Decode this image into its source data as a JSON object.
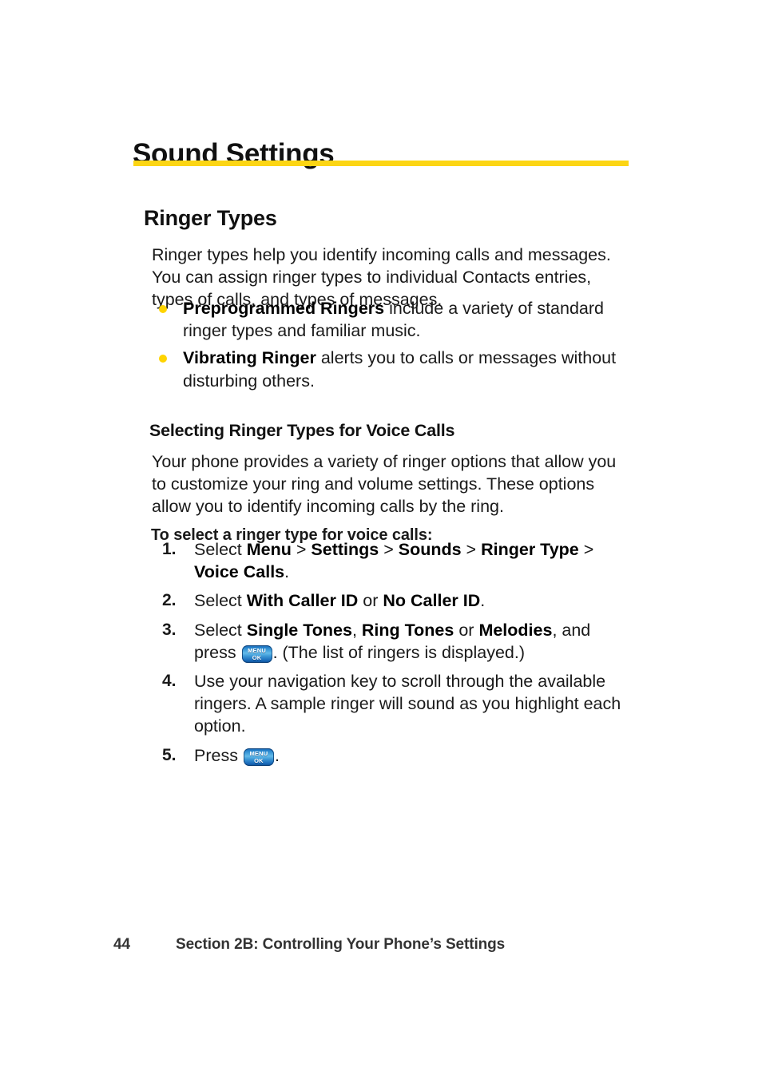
{
  "document": {
    "chapter_title": "Sound Settings",
    "accent_color": "#FCD514",
    "bullet_color": "#FFD400",
    "key_color": "#2f8ed2"
  },
  "section": {
    "heading": "Ringer Types",
    "intro_paragraph": "Ringer types help you identify incoming calls and messages. You can assign ringer types to individual Contacts entries, types of calls, and types of messages.",
    "bullets": [
      {
        "term": "Preprogrammed Ringers",
        "text": " include a variety of standard ringer types and familiar music."
      },
      {
        "term": "Vibrating Ringer",
        "text": " alerts you to calls or messages without disturbing others."
      }
    ]
  },
  "subsection": {
    "heading": "Selecting Ringer Types for Voice Calls",
    "paragraph": "Your phone provides a variety of ringer options that allow you to customize your ring and volume settings. These options allow you to identify incoming calls by the ring.",
    "procedure_lead": "To select a ringer type for voice calls:",
    "steps": [
      {
        "number": "1.",
        "parts": [
          {
            "type": "text",
            "value": "Select "
          },
          {
            "type": "bold",
            "value": "Menu"
          },
          {
            "type": "text",
            "value": " > "
          },
          {
            "type": "bold",
            "value": "Settings"
          },
          {
            "type": "text",
            "value": " > "
          },
          {
            "type": "bold",
            "value": "Sounds"
          },
          {
            "type": "text",
            "value": " > "
          },
          {
            "type": "bold",
            "value": "Ringer Type"
          },
          {
            "type": "text",
            "value": " > "
          },
          {
            "type": "bold",
            "value": "Voice Calls"
          },
          {
            "type": "text",
            "value": "."
          }
        ]
      },
      {
        "number": "2.",
        "parts": [
          {
            "type": "text",
            "value": "Select "
          },
          {
            "type": "bold",
            "value": "With Caller ID"
          },
          {
            "type": "text",
            "value": " or "
          },
          {
            "type": "bold",
            "value": "No Caller ID"
          },
          {
            "type": "text",
            "value": "."
          }
        ]
      },
      {
        "number": "3.",
        "parts": [
          {
            "type": "text",
            "value": "Select "
          },
          {
            "type": "bold",
            "value": "Single Tones"
          },
          {
            "type": "text",
            "value": ", "
          },
          {
            "type": "bold",
            "value": "Ring Tones"
          },
          {
            "type": "text",
            "value": " or "
          },
          {
            "type": "bold",
            "value": "Melodies"
          },
          {
            "type": "text",
            "value": ", and press "
          },
          {
            "type": "key",
            "value": "menu-ok-key"
          },
          {
            "type": "text",
            "value": ". (The list of ringers is displayed.)"
          }
        ]
      },
      {
        "number": "4.",
        "parts": [
          {
            "type": "text",
            "value": "Use your navigation key to scroll through the available ringers. A sample ringer will sound as you highlight each option."
          }
        ]
      },
      {
        "number": "5.",
        "parts": [
          {
            "type": "text",
            "value": "Press "
          },
          {
            "type": "key",
            "value": "menu-ok-key"
          },
          {
            "type": "text",
            "value": "."
          }
        ]
      }
    ]
  },
  "key_glyph": {
    "top_label": "MENU",
    "bottom_label": "OK"
  },
  "footer": {
    "page_number": "44",
    "section_label": "Section 2B: Controlling Your Phone’s Settings"
  }
}
